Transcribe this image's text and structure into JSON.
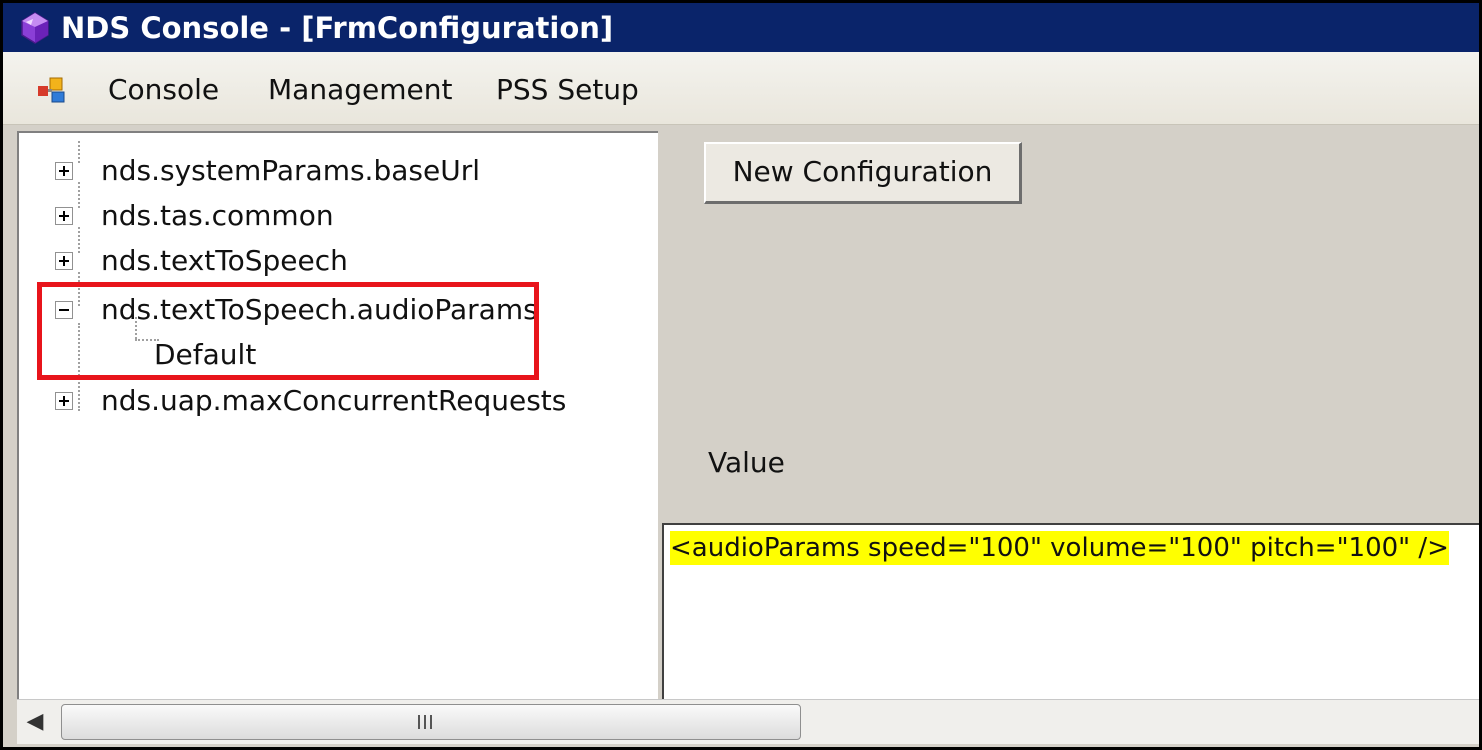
{
  "window": {
    "title": "NDS Console - [FrmConfiguration]",
    "app_icon": "crystal-gem-icon"
  },
  "menubar": {
    "icon": "console-app-icon",
    "items": [
      {
        "label": "Console"
      },
      {
        "label": "Management"
      },
      {
        "label": "PSS Setup"
      }
    ]
  },
  "tree": {
    "nodes": [
      {
        "label": "nds.systemParams.baseUrl",
        "expanded": false
      },
      {
        "label": "nds.tas.common",
        "expanded": false
      },
      {
        "label": "nds.textToSpeech",
        "expanded": false
      },
      {
        "label": "nds.textToSpeech.audioParams",
        "expanded": true,
        "children": [
          {
            "label": "Default"
          }
        ]
      },
      {
        "label": "nds.uap.maxConcurrentRequests",
        "expanded": false
      }
    ],
    "highlight_color": "#e8141b"
  },
  "detail": {
    "new_config_button": "New Configuration",
    "value_label": "Value",
    "value_text": "<audioParams speed=\"100\" volume=\"100\" pitch=\"100\" />",
    "value_highlight_color": "#ffff00"
  },
  "scrollbar": {
    "left_arrow": "◀",
    "thumb_grip": "grip-lines-icon"
  }
}
